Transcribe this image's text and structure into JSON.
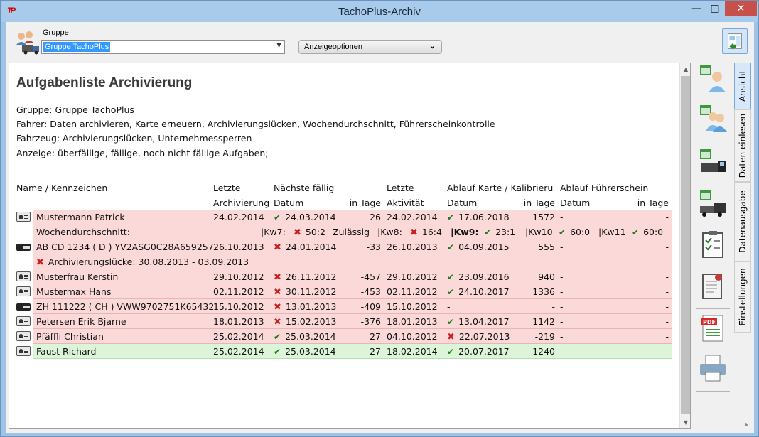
{
  "window": {
    "title": "TachoPlus-Archiv",
    "minimize": "—",
    "maximize": "□",
    "close": "✕"
  },
  "toolbar": {
    "group_label": "Gruppe",
    "group_value": "Gruppe TachoPlus",
    "options_label": "Anzeigeoptionen",
    "options_chevron": "»"
  },
  "report": {
    "title": "Aufgabenliste Archivierung",
    "lines": [
      "Gruppe: Gruppe TachoPlus",
      "Fahrer:  Daten archivieren, Karte erneuern, Archivierungslücken, Wochendurchschnitt, Führerscheinkontrolle",
      "Fahrzeug:  Archivierungslücken, Unternehmessperren",
      "Anzeige: überfällige, fällige, noch nicht fällige Aufgaben;"
    ]
  },
  "table": {
    "headers": {
      "name": "Name / Kennzeichen",
      "last1": "Letzte",
      "last2": "Archivierung",
      "next1": "Nächste fällig",
      "next_date": "Datum",
      "next_days": "in Tage",
      "act1": "Letzte",
      "act2": "Aktivität",
      "card1": "Ablauf Karte / Kalibrieru",
      "card_date": "Datum",
      "card_days": "in Tage",
      "lic1": "Ablauf Führerschein",
      "lic_date": "Datum",
      "lic_days": "in Tage"
    },
    "rows": [
      {
        "name": "Mustermann Patrick",
        "last": "24.02.2014",
        "next": "24.03.2014",
        "next_ok": true,
        "days": "26",
        "act": "24.02.2014",
        "card": "17.06.2018",
        "card_ok": true,
        "card_days": "1572",
        "lic": "-",
        "lic_days": "-"
      },
      {
        "name": "AB CD 1234 ( D ) YV2ASG0C28A659257",
        "last": "26.10.2013",
        "next": "24.01.2014",
        "next_ok": false,
        "days": "-33",
        "act": "26.10.2013",
        "card": "04.09.2015",
        "card_ok": true,
        "card_days": "555",
        "lic": "-",
        "lic_days": "-"
      },
      {
        "name": "Musterfrau Kerstin",
        "last": "29.10.2012",
        "next": "26.11.2012",
        "next_ok": false,
        "days": "-457",
        "act": "29.10.2012",
        "card": "23.09.2016",
        "card_ok": true,
        "card_days": "940",
        "lic": "-",
        "lic_days": "-"
      },
      {
        "name": "Mustermax Hans",
        "last": "02.11.2012",
        "next": "30.11.2012",
        "next_ok": false,
        "days": "-453",
        "act": "02.11.2012",
        "card": "24.10.2017",
        "card_ok": true,
        "card_days": "1336",
        "lic": "-",
        "lic_days": "-"
      },
      {
        "name": "ZH 111222 ( CH ) VWW9702751K65432",
        "last": "15.10.2012",
        "next": "13.01.2013",
        "next_ok": false,
        "days": "-409",
        "act": "15.10.2012",
        "card": "-",
        "card_days": "-",
        "lic": "-",
        "lic_days": "-"
      },
      {
        "name": "Petersen Erik Bjarne",
        "last": "18.01.2013",
        "next": "15.02.2013",
        "next_ok": false,
        "days": "-376",
        "act": "18.01.2013",
        "card": "13.04.2017",
        "card_ok": true,
        "card_days": "1142",
        "lic": "-",
        "lic_days": "-"
      },
      {
        "name": "Pfäffli Christian",
        "last": "25.02.2014",
        "next": "25.03.2014",
        "next_ok": true,
        "days": "27",
        "act": "04.10.2012",
        "card": "22.07.2013",
        "card_ok": false,
        "card_days": "-219",
        "lic": "-",
        "lic_days": "-"
      },
      {
        "name": "Faust Richard",
        "last": "25.02.2014",
        "next": "25.03.2014",
        "next_ok": true,
        "days": "27",
        "act": "18.02.2014",
        "card": "20.07.2017",
        "card_ok": true,
        "card_days": "1240",
        "lic": "-",
        "lic_days": "-"
      }
    ],
    "week_row": {
      "label": "Wochendurchschnitt:",
      "kw7": "|Kw7:",
      "kw7_val": "50:2",
      "zul": "Zulässig",
      "kw8": "|Kw8:",
      "kw8_val": "16:4",
      "kw9": "|Kw9:",
      "kw9_val": "23:1",
      "kw10": "|Kw10",
      "kw10_val": "60:0",
      "kw11": "|Kw11",
      "kw11_val": "60:0"
    },
    "gap_row": {
      "label": "Archivierungslücke: 30.08.2013 - 03.09.2013"
    }
  },
  "tabs": [
    "Ansicht",
    "Daten einlesen",
    "Datenausgabe",
    "Einstellungen"
  ],
  "colors": {
    "overdue_row": "#fcd9d9",
    "ok_row": "#dcf5d9",
    "check": "#1d7a1d",
    "cross": "#c81e1e"
  }
}
